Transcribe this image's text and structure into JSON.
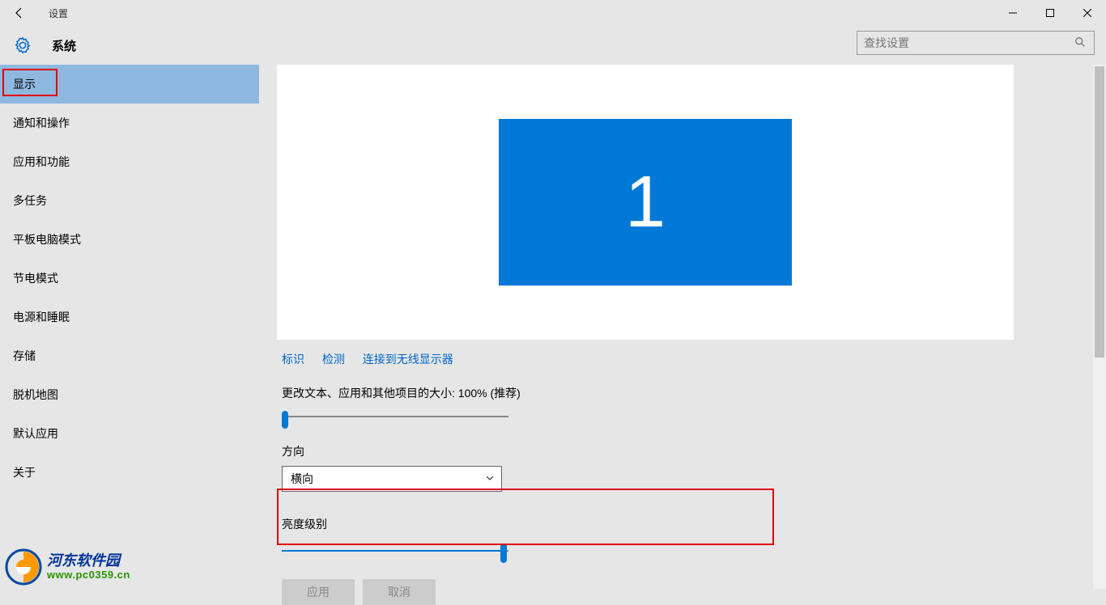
{
  "titlebar": {
    "label": "设置"
  },
  "header": {
    "title": "系统"
  },
  "search": {
    "placeholder": "查找设置"
  },
  "sidebar": {
    "items": [
      {
        "label": "显示",
        "active": true
      },
      {
        "label": "通知和操作"
      },
      {
        "label": "应用和功能"
      },
      {
        "label": "多任务"
      },
      {
        "label": "平板电脑模式"
      },
      {
        "label": "节电模式"
      },
      {
        "label": "电源和睡眠"
      },
      {
        "label": "存储"
      },
      {
        "label": "脱机地图"
      },
      {
        "label": "默认应用"
      },
      {
        "label": "关于"
      }
    ]
  },
  "main": {
    "monitor_number": "1",
    "links": {
      "identify": "标识",
      "detect": "检测",
      "wireless": "连接到无线显示器"
    },
    "scale_label": "更改文本、应用和其他项目的大小: 100% (推荐)",
    "orientation_label": "方向",
    "orientation_value": "横向",
    "brightness_label": "亮度级别",
    "apply_btn": "应用",
    "cancel_btn": "取消"
  },
  "watermark": {
    "name": "河东软件园",
    "url": "www.pc0359.cn"
  }
}
